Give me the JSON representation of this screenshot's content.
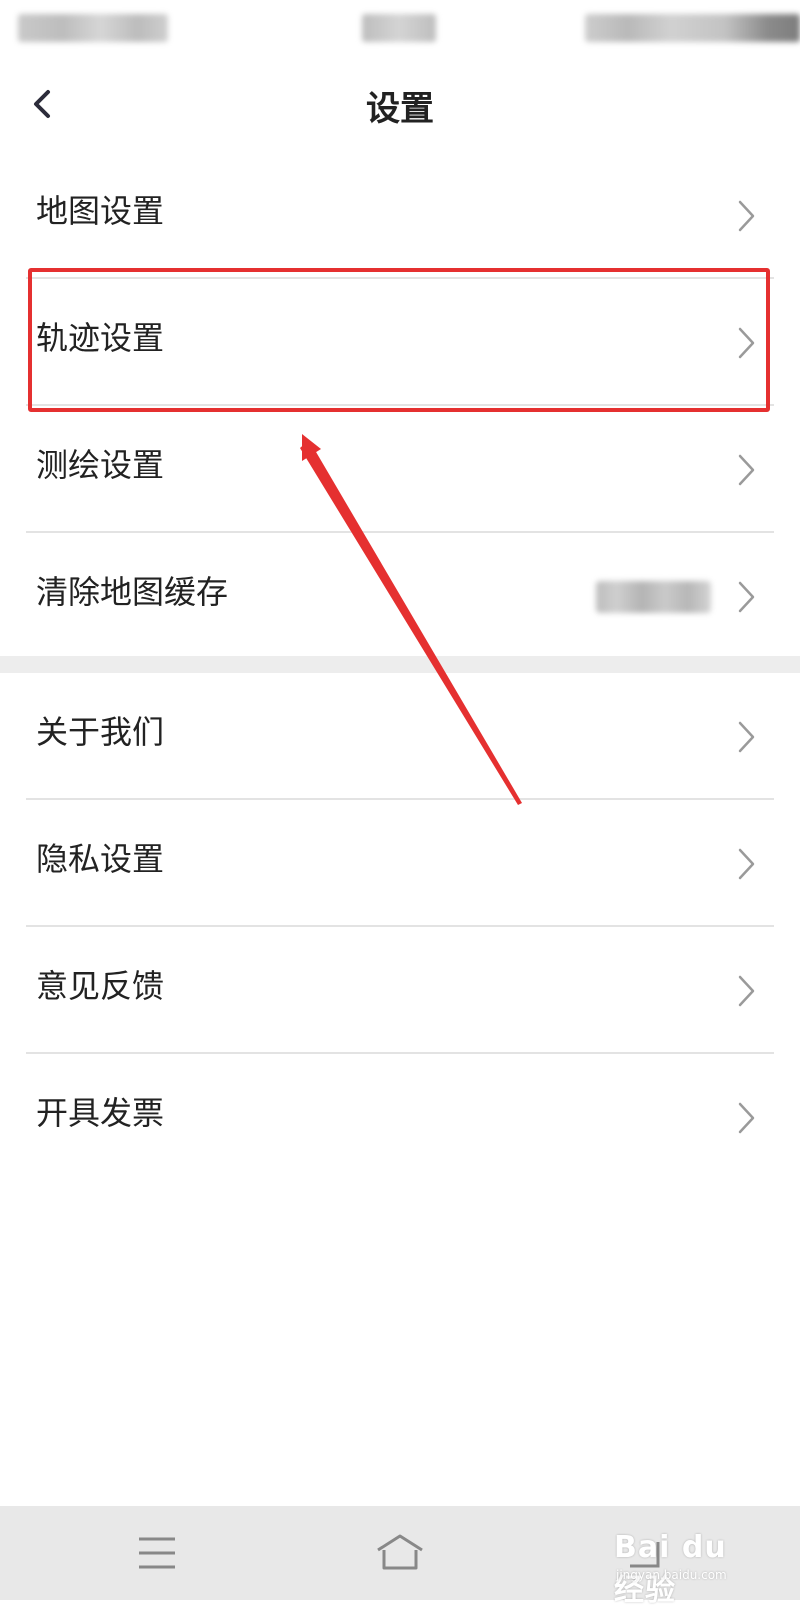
{
  "header": {
    "title": "设置",
    "back_icon": "chevron-left-icon"
  },
  "settings_group_1": [
    {
      "label": "地图设置",
      "icon": "chevron-right-icon"
    },
    {
      "label": "轨迹设置",
      "icon": "chevron-right-icon",
      "highlighted": true
    },
    {
      "label": "测绘设置",
      "icon": "chevron-right-icon"
    },
    {
      "label": "清除地图缓存",
      "icon": "chevron-right-icon",
      "value_obscured": true
    }
  ],
  "settings_group_2": [
    {
      "label": "关于我们",
      "icon": "chevron-right-icon"
    },
    {
      "label": "隐私设置",
      "icon": "chevron-right-icon"
    },
    {
      "label": "意见反馈",
      "icon": "chevron-right-icon"
    },
    {
      "label": "开具发票",
      "icon": "chevron-right-icon"
    }
  ],
  "system_nav": {
    "icons": [
      "menu-icon",
      "home-icon",
      "back-icon"
    ]
  },
  "watermark": {
    "brand": "Bai du 经验",
    "url": "jingyan.baidu.com"
  },
  "colors": {
    "annotation_red": "#e53030",
    "text": "#222222",
    "divider": "#e3e3e3",
    "section_gap": "#ededed",
    "nav_bar_bg": "#e8e8e8"
  }
}
